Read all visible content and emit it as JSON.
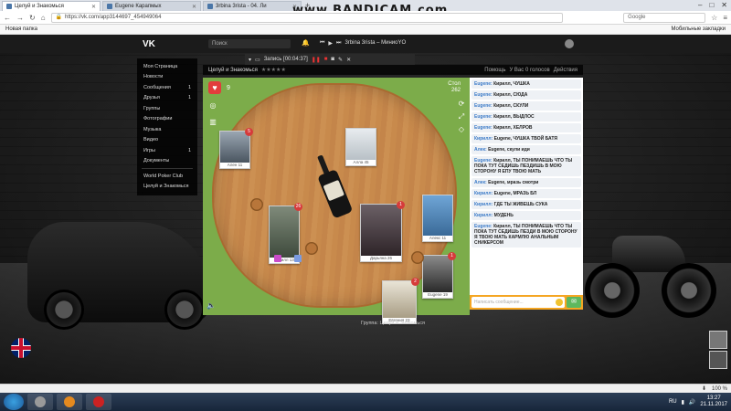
{
  "browser": {
    "tabs": [
      {
        "label": "Целуй и Знакомься",
        "active": true
      },
      {
        "label": "Eugene Карапмых",
        "active": false
      },
      {
        "label": "3rbina 3rista - 04. Ли",
        "active": false
      }
    ],
    "url": "https://vk.com/app3144697_454949064",
    "search_placeholder": "Google",
    "bookmark_left": "Новая папка",
    "bookmark_right": "Мобильные закладки",
    "watermark": "www.BANDICAM.com"
  },
  "vk": {
    "logo": "VK",
    "search_placeholder": "Поиск",
    "now_playing": "3rbina 3rista – МиниоYO",
    "menu": [
      {
        "label": "Моя Страница",
        "count": ""
      },
      {
        "label": "Новости",
        "count": ""
      },
      {
        "label": "Сообщения",
        "count": "1"
      },
      {
        "label": "Друзья",
        "count": "1"
      },
      {
        "label": "Группы",
        "count": ""
      },
      {
        "label": "Фотографии",
        "count": ""
      },
      {
        "label": "Музыка",
        "count": ""
      },
      {
        "label": "Видео",
        "count": ""
      },
      {
        "label": "Игры",
        "count": "1"
      },
      {
        "label": "Документы",
        "count": ""
      }
    ],
    "menu_extra": [
      "World Poker Club",
      "Целуй и Знакомься"
    ]
  },
  "recorder": {
    "label": "Запись [00:04:37]"
  },
  "app": {
    "title": "Целуй и Знакомься",
    "stars": "★★★★★",
    "help": "Помощь",
    "online": "У Вас 0 голосов",
    "actions": "Действия"
  },
  "game": {
    "hearts_count": "9",
    "table_label": "Стол",
    "table_number": "262",
    "players": [
      {
        "name": "Ален 11",
        "badge": "5"
      },
      {
        "name": "Алла 45",
        "badge": ""
      },
      {
        "name": "Кирилл 13",
        "badge": "26"
      },
      {
        "name": "Дарьяна 26",
        "badge": "1"
      },
      {
        "name": "Евгения 23",
        "badge": "2"
      },
      {
        "name": "Eugene 19",
        "badge": "1"
      },
      {
        "name": "Алекс 11",
        "badge": "4"
      },
      {
        "name": "Наталья 17",
        "badge": ""
      }
    ]
  },
  "chat": {
    "messages": [
      {
        "from": "Eugene:",
        "text": "Кирилл, ЧУШКА"
      },
      {
        "from": "Eugene:",
        "text": "Кирилл, СЮДА"
      },
      {
        "from": "Eugene:",
        "text": "Кирилл, СКУЛИ"
      },
      {
        "from": "Eugene:",
        "text": "Кирилл, ВЫДЛОС"
      },
      {
        "from": "Eugene:",
        "text": "Кирилл, ХЕЛРОВ"
      },
      {
        "from": "Кирилл:",
        "text": "Eugene, ЧУШКА ТВОЙ БАТЯ"
      },
      {
        "from": "Алек:",
        "text": "Eugene, скули иди"
      },
      {
        "from": "Eugene:",
        "text": "Кирилл, ТЫ ПОНИМАЕШЬ ЧТО ТЫ ПОКА ТУТ СЕДИШЬ ПЕЗДИШЬ В МОЮ СТОРОНУ Я ЕПУ ТВОЮ МАТЬ"
      },
      {
        "from": "Алек:",
        "text": "Eugene, мразь смотри"
      },
      {
        "from": "Кирилл:",
        "text": "Eugene, МРАЗЬ БЛ"
      },
      {
        "from": "Кирилл:",
        "text": "ГДЕ ТЫ ЖИВЕШЬ СУКА"
      },
      {
        "from": "Кирилл:",
        "text": "МУДЕНЬ"
      },
      {
        "from": "Eugene:",
        "text": "Кирилл, ТЫ ПОНИМАЕШЬ ЧТО ТЫ ПОКА ТУТ СЕДИШЬ ПЕЗДИ В МОЮ СТОРОНУ Я ТВОЮ МАТЬ КАРМЛЮ АНАЛЬНЫМ СНИКЕРСОМ"
      }
    ],
    "input_placeholder": "Написать сообщение..."
  },
  "group_line": "Группа: Целуй и Знакомься",
  "statusbar": {
    "zoom": "100 %"
  },
  "taskbar": {
    "lang": "RU",
    "time": "13:27",
    "date": "21.11.2017"
  },
  "colors": {
    "game_bg": "#7cac4a",
    "chat_input_bg": "#f5a623",
    "heart": "#e23c3c",
    "vk_header": "#1b1b1b"
  }
}
